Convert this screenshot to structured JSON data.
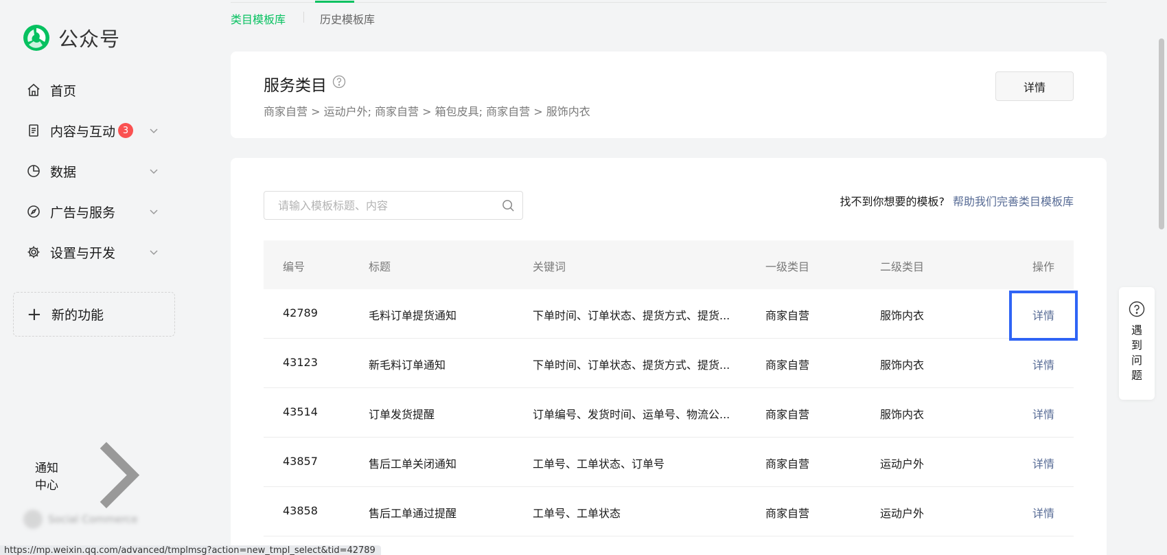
{
  "brand": {
    "name": "公众号"
  },
  "sidebar": {
    "items": [
      {
        "label": "首页"
      },
      {
        "label": "内容与互动",
        "badge": "3"
      },
      {
        "label": "数据"
      },
      {
        "label": "广告与服务"
      },
      {
        "label": "设置与开发"
      }
    ],
    "new_feature": "新的功能",
    "notify": "通知中心",
    "account": "Social Commerce"
  },
  "tabs": [
    {
      "label": "类目模板库",
      "active": true
    },
    {
      "label": "历史模板库",
      "active": false
    }
  ],
  "service": {
    "title": "服务类目",
    "desc": "商家自营 > 运动户外; 商家自营 > 箱包皮具; 商家自营 > 服饰内衣",
    "detail_button": "详情"
  },
  "search": {
    "placeholder": "请输入模板标题、内容"
  },
  "hint": {
    "text": "找不到你想要的模板?",
    "link": "帮助我们完善类目模板库"
  },
  "table": {
    "headers": [
      "编号",
      "标题",
      "关键词",
      "一级类目",
      "二级类目",
      "操作"
    ],
    "rows": [
      {
        "id": "42789",
        "title": "毛料订单提货通知",
        "keywords": "下单时间、订单状态、提货方式、提货...",
        "cat1": "商家自营",
        "cat2": "服饰内衣",
        "action": "详情"
      },
      {
        "id": "43123",
        "title": "新毛料订单通知",
        "keywords": "下单时间、订单状态、提货方式、提货...",
        "cat1": "商家自营",
        "cat2": "服饰内衣",
        "action": "详情"
      },
      {
        "id": "43514",
        "title": "订单发货提醒",
        "keywords": "订单编号、发货时间、运单号、物流公...",
        "cat1": "商家自营",
        "cat2": "服饰内衣",
        "action": "详情"
      },
      {
        "id": "43857",
        "title": "售后工单关闭通知",
        "keywords": "工单号、工单状态、订单号",
        "cat1": "商家自营",
        "cat2": "运动户外",
        "action": "详情"
      },
      {
        "id": "43858",
        "title": "售后工单通过提醒",
        "keywords": "工单号、工单状态",
        "cat1": "商家自营",
        "cat2": "运动户外",
        "action": "详情"
      }
    ]
  },
  "help_widget": {
    "text": "遇到问题"
  },
  "status_url": "https://mp.weixin.qq.com/advanced/tmplmsg?action=new_tmpl_select&tid=42789",
  "colors": {
    "accent": "#07c160",
    "link": "#576b95",
    "badge": "#fa5151",
    "highlight": "#2f64f5"
  }
}
